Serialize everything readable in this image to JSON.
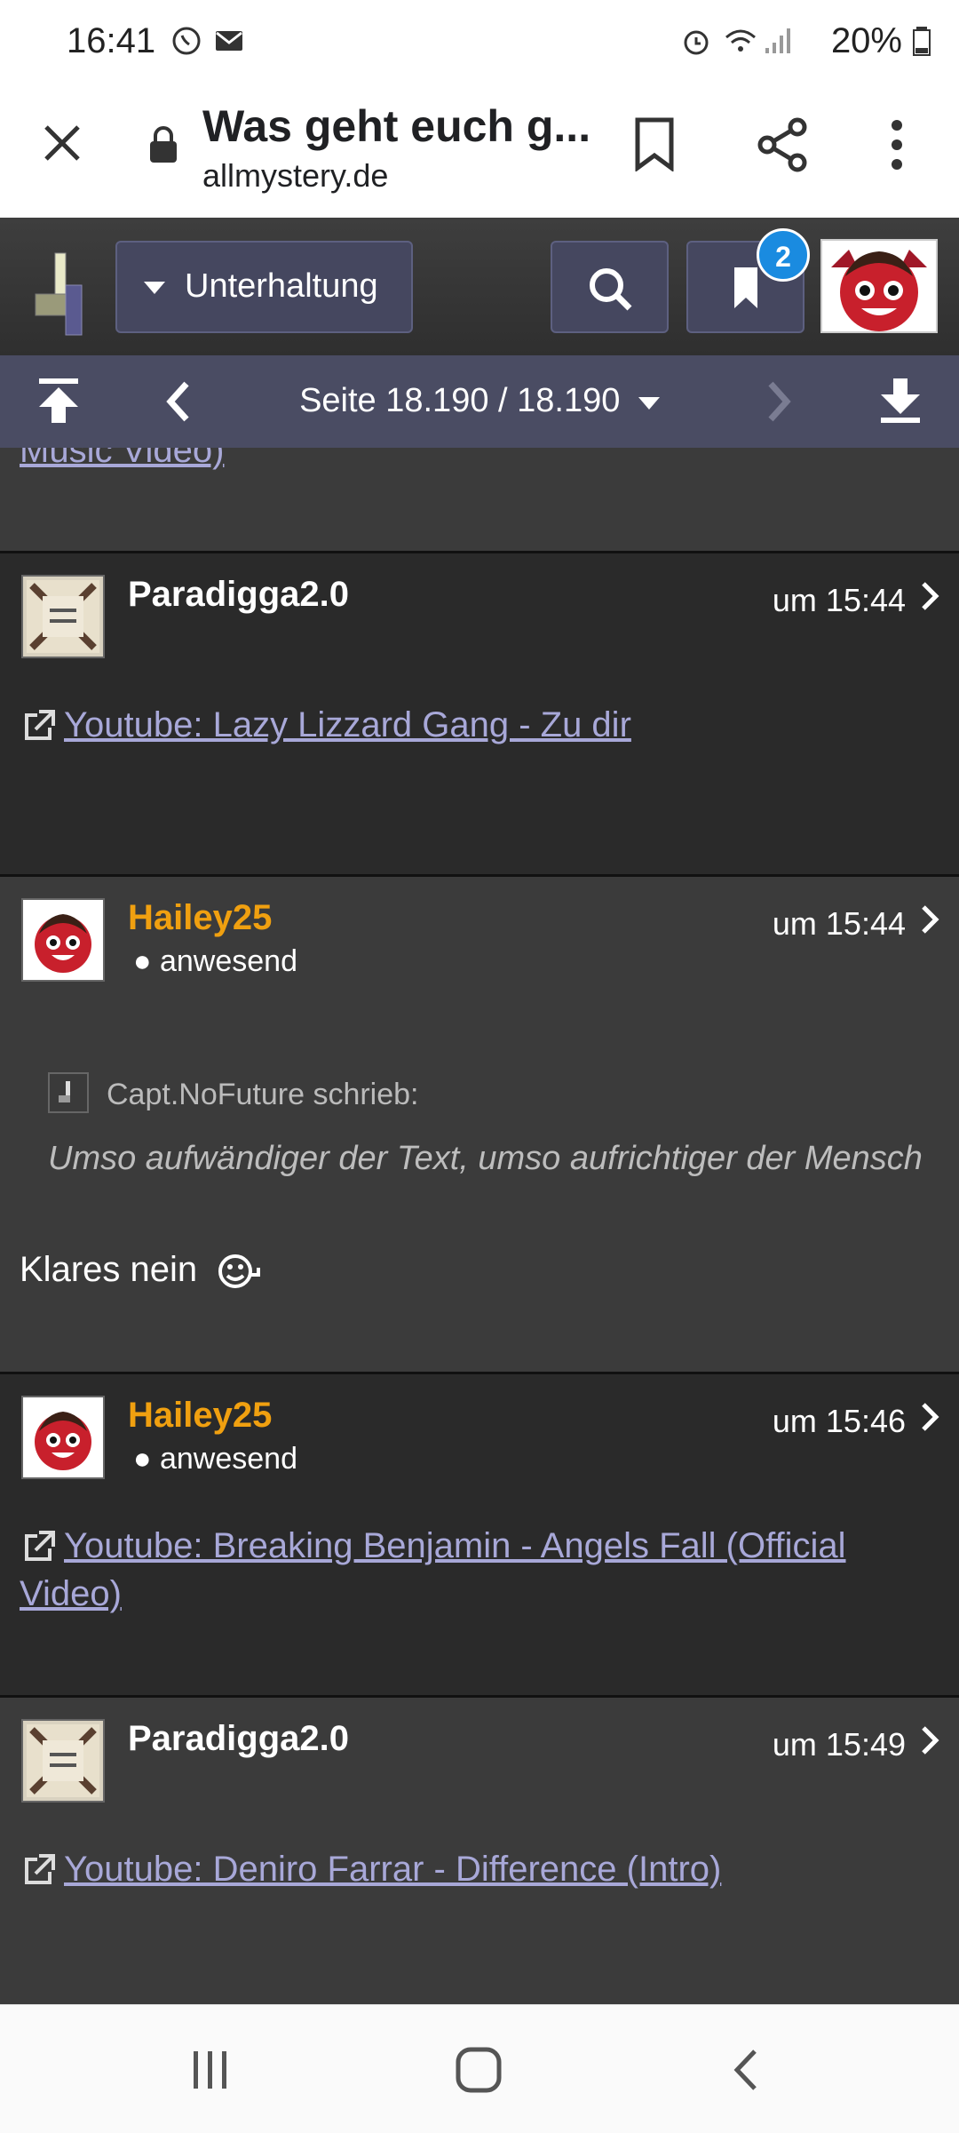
{
  "status_bar": {
    "time": "16:41",
    "battery": "20%"
  },
  "browser": {
    "title": "Was geht euch g...",
    "url": "allmystery.de"
  },
  "site_header": {
    "category": "Unterhaltung",
    "bookmark_badge": "2"
  },
  "page_nav": {
    "label": "Seite 18.190 / 18.190"
  },
  "top_fragment": {
    "link_text": "Music Video)"
  },
  "posts": [
    {
      "user": "Paradigga2.0",
      "time": "um 15:44",
      "link": "Youtube: Lazy Lizzard Gang - Zu dir"
    },
    {
      "user": "Hailey25",
      "status": "anwesend",
      "time": "um 15:44",
      "quote_author": "Capt.NoFuture schrieb:",
      "quote": "Umso aufwändiger der Text, umso aufrichtiger der Mensch",
      "text": "Klares nein"
    },
    {
      "user": "Hailey25",
      "status": "anwesend",
      "time": "um 15:46",
      "link": "Youtube: Breaking Benjamin - Angels Fall (Official Video)"
    },
    {
      "user": "Paradigga2.0",
      "time": "um 15:49",
      "link": "Youtube: Deniro Farrar - Difference (Intro)"
    }
  ],
  "colors": {
    "page_nav_bg": "#4a4c63",
    "username_orange": "#f0a010",
    "link": "#a8a8d8",
    "badge": "#1a8be0"
  },
  "icons": [
    "whatsapp-icon",
    "mail-icon",
    "alarm-icon",
    "wifi-icon",
    "signal-icon",
    "battery-icon",
    "close-icon",
    "lock-icon",
    "bookmark-icon",
    "share-icon",
    "more-icon",
    "site-logo",
    "dropdown-icon",
    "search-icon",
    "bookmark-icon",
    "avatar",
    "first-page-icon",
    "prev-page-icon",
    "next-page-icon",
    "last-page-icon",
    "external-link-icon",
    "chevron-right-icon",
    "smiley-icon",
    "recents-icon",
    "home-icon",
    "back-icon"
  ]
}
